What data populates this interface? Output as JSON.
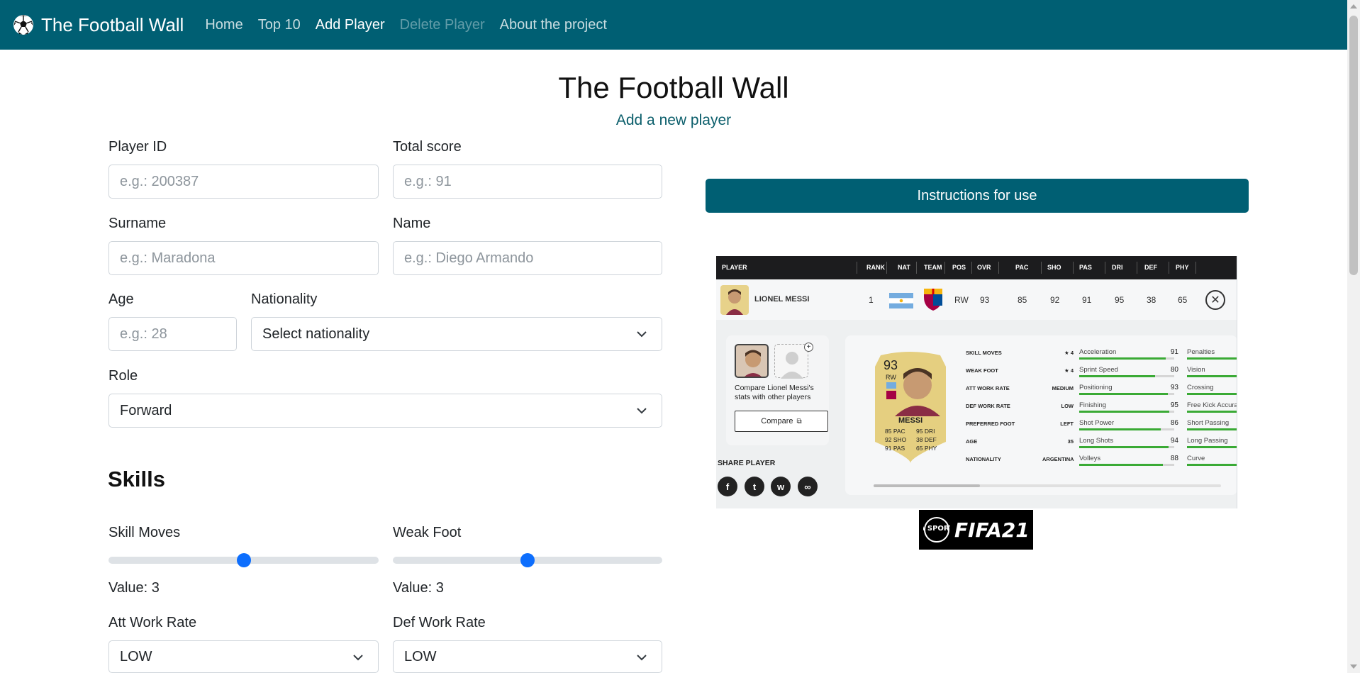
{
  "nav": {
    "brand": "The Football Wall",
    "links": [
      "Home",
      "Top 10",
      "Add Player",
      "Delete Player",
      "About the project"
    ]
  },
  "header": {
    "title": "The Football Wall",
    "subtitle": "Add a new player"
  },
  "form": {
    "player_id": {
      "label": "Player ID",
      "placeholder": "e.g.: 200387"
    },
    "total_score": {
      "label": "Total score",
      "placeholder": "e.g.: 91"
    },
    "surname": {
      "label": "Surname",
      "placeholder": "e.g.: Maradona"
    },
    "name": {
      "label": "Name",
      "placeholder": "e.g.: Diego Armando"
    },
    "age": {
      "label": "Age",
      "placeholder": "e.g.: 28"
    },
    "nationality": {
      "label": "Nationality",
      "value": "Select nationality"
    },
    "role": {
      "label": "Role",
      "value": "Forward"
    }
  },
  "skills": {
    "title": "Skills",
    "skill_moves": {
      "label": "Skill Moves",
      "value_text": "Value: 3",
      "value": 3,
      "min": 1,
      "max": 5
    },
    "weak_foot": {
      "label": "Weak Foot",
      "value_text": "Value: 3",
      "value": 3,
      "min": 1,
      "max": 5
    },
    "att_work_rate": {
      "label": "Att Work Rate",
      "value": "LOW"
    },
    "def_work_rate": {
      "label": "Def Work Rate",
      "value": "LOW"
    }
  },
  "instructions_button": "Instructions for use",
  "example_card": {
    "headers": [
      "PLAYER",
      "RANK",
      "NAT",
      "TEAM",
      "POS",
      "OVR",
      "PAC",
      "SHO",
      "PAS",
      "DRI",
      "DEF",
      "PHY"
    ],
    "row": {
      "player": "LIONEL MESSI",
      "rank": "1",
      "pos": "RW",
      "ovr": "93",
      "pac": "85",
      "sho": "92",
      "pas": "91",
      "dri": "95",
      "def": "38",
      "phy": "65"
    },
    "compare_text": "Compare Lionel Messi's stats with other players",
    "compare_button": "Compare",
    "share_label": "SHARE PLAYER",
    "fut": {
      "rating": "93",
      "pos": "RW",
      "name": "MESSI",
      "stats_left": [
        "85 PAC",
        "92 SHO",
        "91 PAS"
      ],
      "stats_right": [
        "95 DRI",
        "38 DEF",
        "65 PHY"
      ]
    },
    "info": [
      {
        "k": "SKILL MOVES",
        "v": "★ 4"
      },
      {
        "k": "WEAK FOOT",
        "v": "★ 4"
      },
      {
        "k": "ATT WORK RATE",
        "v": "MEDIUM"
      },
      {
        "k": "DEF WORK RATE",
        "v": "LOW"
      },
      {
        "k": "PREFERRED FOOT",
        "v": "LEFT"
      },
      {
        "k": "AGE",
        "v": "35"
      },
      {
        "k": "NATIONALITY",
        "v": "ARGENTINA"
      }
    ],
    "attrs": [
      {
        "name": "Acceleration",
        "value": "91"
      },
      {
        "name": "Sprint Speed",
        "value": "80"
      },
      {
        "name": "Positioning",
        "value": "93"
      },
      {
        "name": "Finishing",
        "value": "95"
      },
      {
        "name": "Shot Power",
        "value": "86"
      },
      {
        "name": "Long Shots",
        "value": "94"
      },
      {
        "name": "Volleys",
        "value": "88"
      }
    ],
    "attrs2": [
      "Penalties",
      "Vision",
      "Crossing",
      "Free Kick Accuracy",
      "Short Passing",
      "Long Passing",
      "Curve"
    ]
  },
  "logo": {
    "text": "FIFA21",
    "badge": "EA SPORTS"
  },
  "colors": {
    "primary": "#005f73",
    "slider": "#0d6efd",
    "stat_bar": "#3aaa35"
  }
}
